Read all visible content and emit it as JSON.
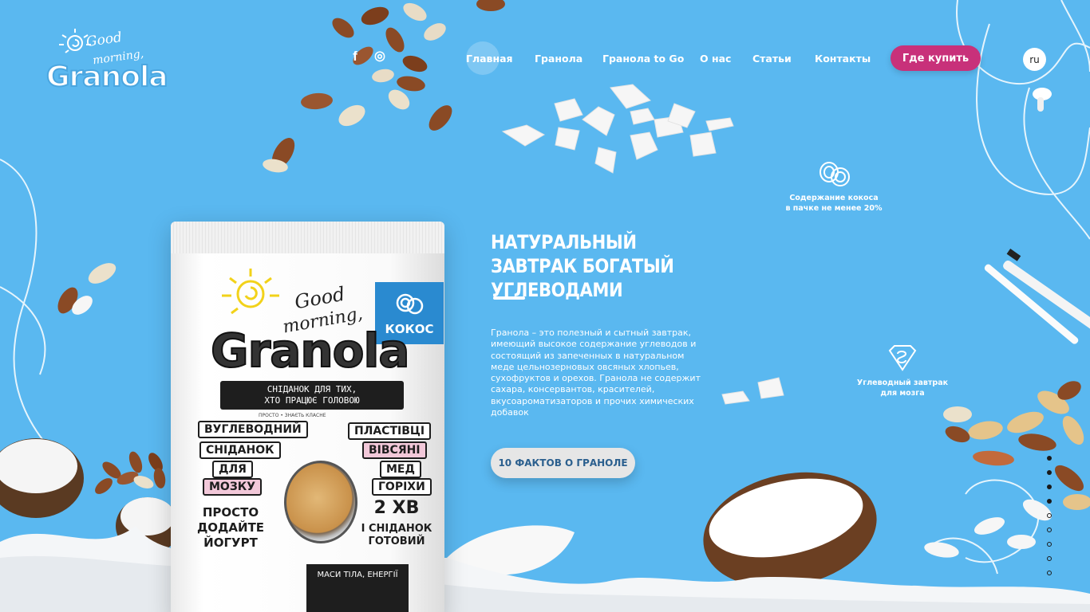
{
  "brand": {
    "logo_line1": "Good",
    "logo_line2": "morning,",
    "logo_line3": "Granola"
  },
  "social": [
    {
      "icon": "facebook-icon",
      "glyph": "f"
    },
    {
      "icon": "instagram-icon",
      "glyph": "◎"
    }
  ],
  "nav": {
    "items": [
      {
        "label": "Главная",
        "active": true
      },
      {
        "label": "Гранола"
      },
      {
        "label": "Гранола to Go"
      },
      {
        "label": "О нас"
      },
      {
        "label": "Статьи"
      },
      {
        "label": "Контакты"
      }
    ],
    "buy_label": "Где купить",
    "lang_label": "ru"
  },
  "hero": {
    "title": "НАТУРАЛЬНЫЙ ЗАВТРАК БОГАТЫЙ УГЛЕВОДАМИ",
    "description": "Гранола – это полезный и сытный завтрак, имеющий высокое содержание углеводов и состоящий из запеченных в натуральном меде цельнозерновых овсяных хлопьев, сухофруктов и орехов. Гранола не содержит сахара, консервантов, красителей, вкусоароматизаторов и прочих химических добавок",
    "cta_label": "10 ФАКТОВ О ГРАНОЛЕ"
  },
  "features": [
    {
      "icon": "coconut-icon",
      "line1": "Содержание кокоса",
      "line2": "в пачке не менее 20%"
    },
    {
      "icon": "brain-diamond-icon",
      "line1": "Углеводный завтрак",
      "line2": "для мозга"
    }
  ],
  "package": {
    "flavor": "КОКОС",
    "good": "Good",
    "morning": "morning,",
    "brand": "Granola",
    "banner_line1": "СНІДАНОК ДЛЯ ТИХ,",
    "banner_line2": "ХТО ПРАЦЮЄ ГОЛОВОЮ",
    "sub": "ПРОСТО • ЗНАЄТЬ КЛАСНЕ",
    "left_labels": [
      "ВУГЛЕВОДНИЙ",
      "СНІДАНОК",
      "ДЛЯ",
      "МОЗКУ"
    ],
    "right_labels": [
      "ПЛАСТІВЦІ",
      "ВІВСЯНІ",
      "МЕД",
      "ГОРІХИ"
    ],
    "left_text": "ПРОСТО ДОДАЙТЕ ЙОГУРТ",
    "right_number": "2 ХВ",
    "right_text": "І СНІДАНОК ГОТОВИЙ",
    "bottom_text": "МАСИ ТІЛА, ЕНЕРГІЇ"
  },
  "pager": {
    "total": 9,
    "active_index": 0
  },
  "colors": {
    "background": "#5ab8f0",
    "buy_button": "#c8317a",
    "cta_button": "#e6e6e6",
    "cta_text": "#2b5f8e"
  }
}
